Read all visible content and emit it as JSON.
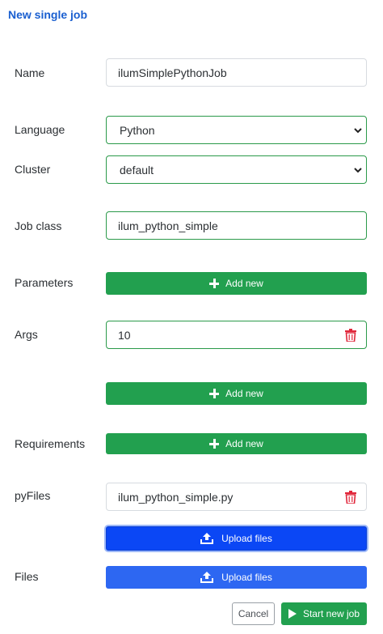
{
  "page": {
    "title": "New single job"
  },
  "form": {
    "name": {
      "label": "Name",
      "value": "ilumSimplePythonJob"
    },
    "language": {
      "label": "Language",
      "value": "Python"
    },
    "cluster": {
      "label": "Cluster",
      "value": "default"
    },
    "job_class": {
      "label": "Job class",
      "value": "ilum_python_simple"
    },
    "parameters": {
      "label": "Parameters",
      "add_label": "Add new"
    },
    "args": {
      "label": "Args",
      "items": [
        "10"
      ],
      "add_label": "Add new"
    },
    "requirements": {
      "label": "Requirements",
      "add_label": "Add new"
    },
    "pyfiles": {
      "label": "pyFiles",
      "items": [
        "ilum_python_simple.py"
      ],
      "upload_label": "Upload files"
    },
    "files": {
      "label": "Files",
      "upload_label": "Upload files"
    }
  },
  "actions": {
    "cancel": "Cancel",
    "start": "Start new job"
  },
  "icons": {
    "plus": "plus-icon",
    "trash": "trash-icon",
    "upload": "upload-icon",
    "play": "play-icon",
    "chevron": "chevron-down-icon"
  },
  "colors": {
    "title": "#1a5fd0",
    "green": "#22a04f",
    "blue": "#2d67f2",
    "focused_blue": "#0b47f5",
    "danger": "#e0263a"
  }
}
